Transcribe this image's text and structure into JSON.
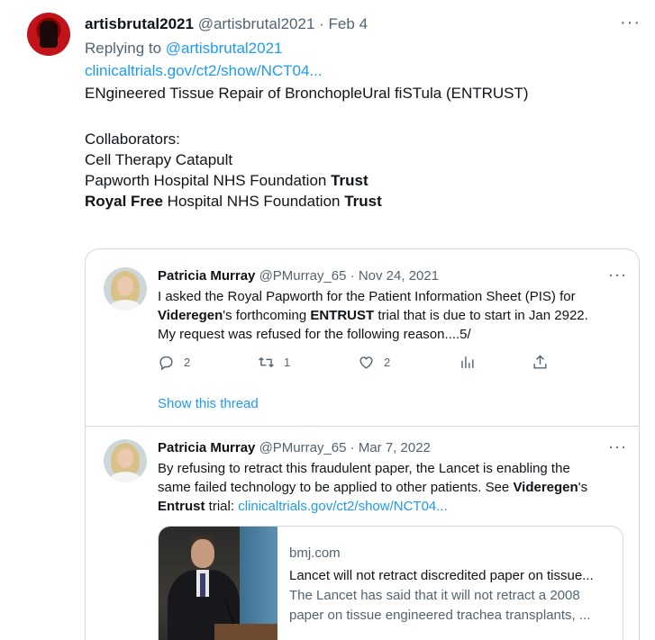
{
  "tweet": {
    "display_name": "artisbrutal2021",
    "handle": "@artisbrutal2021",
    "separator": "·",
    "date": "Feb 4",
    "more": "···",
    "replying_prefix": "Replying to ",
    "replying_handle": "@artisbrutal2021",
    "link": "clinicaltrials.gov/ct2/show/NCT04...",
    "line_title": "ENgineered Tissue Repair of BronchopleUral fiSTula (ENTRUST)",
    "collab_label": "Collaborators:",
    "collab_1": "Cell Therapy Catapult",
    "collab_2_plain": "Papworth Hospital NHS Foundation ",
    "collab_2_bold": "Trust",
    "collab_3_bold_a": "Royal Free",
    "collab_3_plain": " Hospital NHS Foundation ",
    "collab_3_bold_b": "Trust"
  },
  "quote": {
    "post1": {
      "display_name": "Patricia Murray",
      "handle": "@PMurray_65",
      "separator": "·",
      "date": "Nov 24, 2021",
      "more": "···",
      "line1": "I asked the Royal Papworth for the Patient Information Sheet (PIS) for",
      "line2_bold_a": "Videregen",
      "line2_plain_a": "'s forthcoming ",
      "line2_bold_b": "ENTRUST",
      "line2_plain_b": " trial that is due to start in Jan 2922.",
      "line3": "My request was refused for the following reason....5/",
      "replies": "2",
      "retweets": "1",
      "likes": "2",
      "show_thread": "Show this thread"
    },
    "post2": {
      "display_name": "Patricia Murray",
      "handle": "@PMurray_65",
      "separator": "·",
      "date": "Mar 7, 2022",
      "more": "···",
      "line1": "By refusing to retract this fraudulent paper, the Lancet is enabling the",
      "line2_plain": "same failed technology to be applied to other patients. See ",
      "line2_bold": "Videregen",
      "line2_tail": "'s",
      "line3_bold": "Entrust",
      "line3_plain": " trial: ",
      "line3_link": "clinicaltrials.gov/ct2/show/NCT04...",
      "card": {
        "domain": "bmj.com",
        "title": "Lancet will not retract discredited paper on tissue...",
        "desc_line1": "The Lancet has said that it will not retract a 2008",
        "desc_line2": "paper on tissue engineered trachea transplants, ..."
      }
    }
  },
  "colors": {
    "link": "#1d9bf0",
    "muted": "#536471",
    "text": "#0f1419",
    "border": "#cfd9de"
  },
  "icons": [
    "more-icon",
    "reply-icon",
    "retweet-icon",
    "like-icon",
    "views-icon",
    "share-icon"
  ]
}
